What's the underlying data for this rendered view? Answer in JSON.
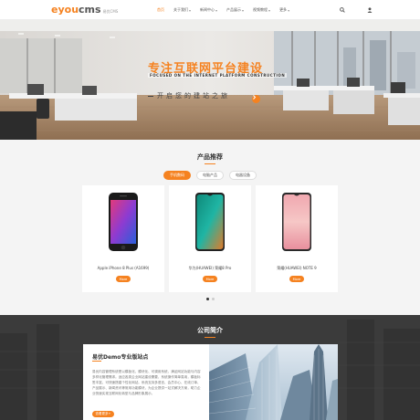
{
  "brand": {
    "logo_e": "eyou",
    "logo_cms": "cms",
    "logo_sub": "易优CMS",
    "accent": "#f58220"
  },
  "nav": {
    "items": [
      {
        "label": "首页",
        "active": true,
        "caret": ""
      },
      {
        "label": "关于我们",
        "active": false,
        "caret": "▾"
      },
      {
        "label": "新闻中心",
        "active": false,
        "caret": "▾"
      },
      {
        "label": "产品展示",
        "active": false,
        "caret": "▾"
      },
      {
        "label": "视频教程",
        "active": false,
        "caret": "▾"
      },
      {
        "label": "更多",
        "active": false,
        "caret": "▾"
      }
    ],
    "search_icon": "search-icon",
    "user_icon": "user-icon"
  },
  "hero": {
    "title": "专注互联网平台建设",
    "subtitle_en": "FOCUSED ON THE INTERNET PLATFORM CONSTRUCTION",
    "slogan": "开启您的建站之旅"
  },
  "products": {
    "title": "产品推荐",
    "tabs": [
      "手机数码",
      "电脑产品",
      "电器设备"
    ],
    "active_tab": 0,
    "items": [
      {
        "name": "Apple iPhone 8 Plus (A1699)",
        "more": "More"
      },
      {
        "name": "华为(HUAWEI) 荣耀8 Pro",
        "more": "More"
      },
      {
        "name": "荣耀(HUAWEI) NOTE 9",
        "more": "More"
      }
    ],
    "dots": 2,
    "active_dot": 0
  },
  "about": {
    "title": "公司简介",
    "heading": "易优Demo专业版站点",
    "text": "易优内容管理系统是以模板化、模块化、可调用系统，满足网站功能与内容多样化管理需求。适应各类企业网站建设需要，系统操作简单易用，模板标签丰富，可快速搭建个性化网站。系统支持多语言、会员中心、在线订单、产品展示、新闻资讯等常用功能模块，为企业提供一站式解决方案，助力企业快速实现互联网化转型与品牌形象展示。",
    "more": "查看更多+"
  }
}
